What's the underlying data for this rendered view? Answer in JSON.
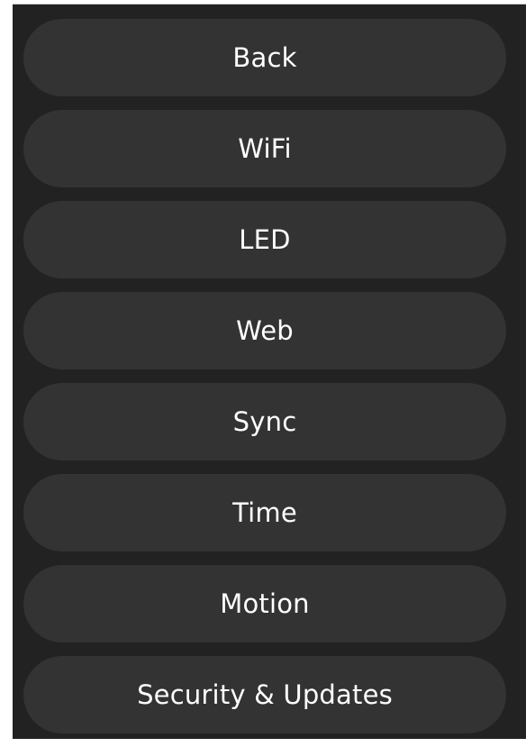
{
  "menu": {
    "items": [
      {
        "label": "Back"
      },
      {
        "label": "WiFi"
      },
      {
        "label": "LED"
      },
      {
        "label": "Web"
      },
      {
        "label": "Sync"
      },
      {
        "label": "Time"
      },
      {
        "label": "Motion"
      },
      {
        "label": "Security & Updates"
      }
    ]
  },
  "colors": {
    "panel_background": "#222222",
    "button_background": "#333333",
    "button_text": "#ffffff",
    "page_background": "#ffffff"
  }
}
